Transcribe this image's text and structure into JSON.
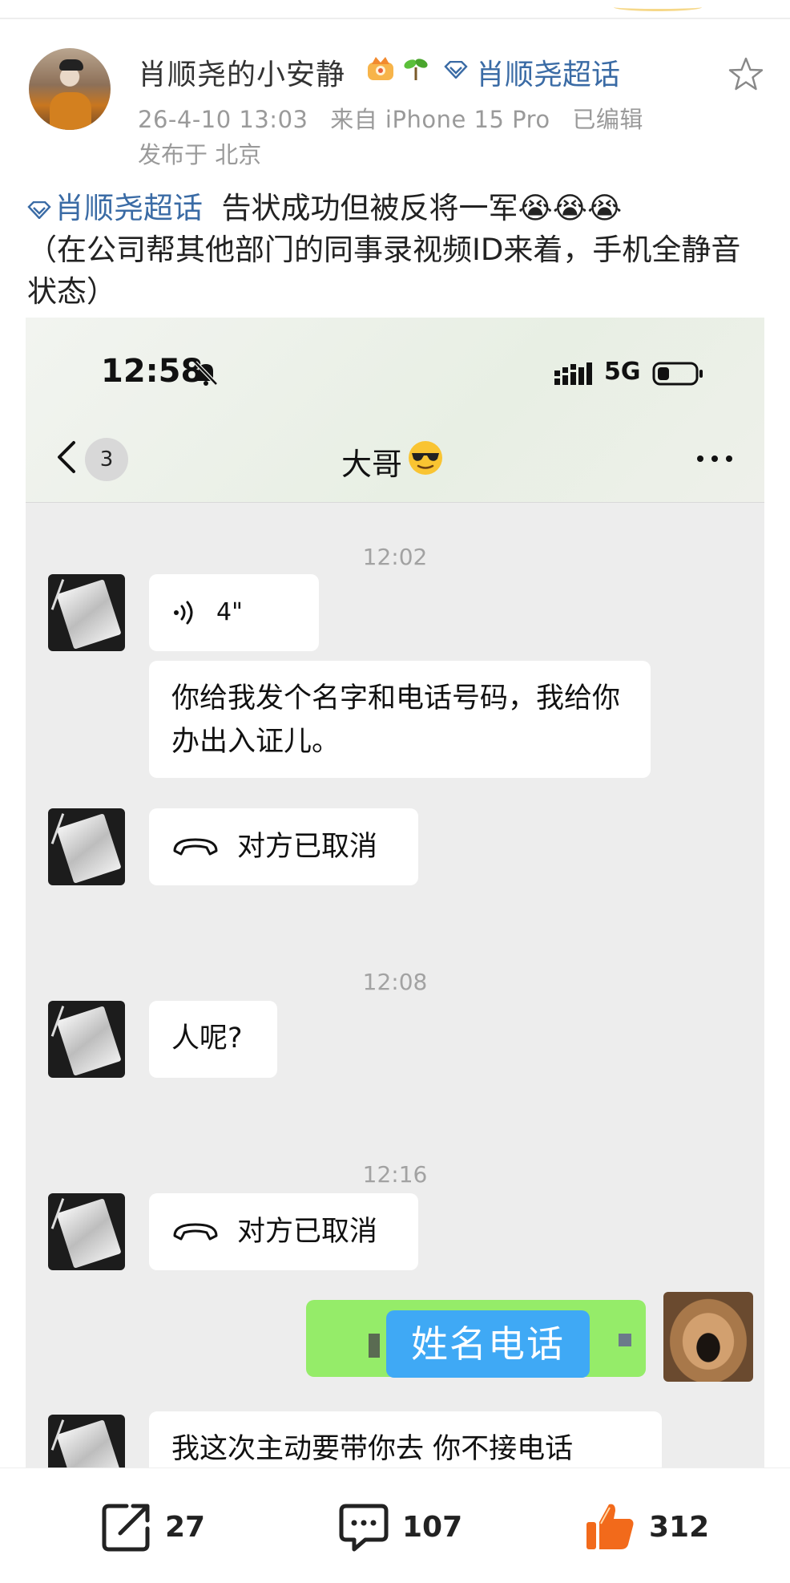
{
  "post": {
    "user_name": "肖顺尧的小安静",
    "topic_label": "肖顺尧超话",
    "meta": {
      "timestamp": "26-4-10 13:03",
      "source": "来自 iPhone 15 Pro",
      "edited": "已编辑"
    },
    "location": "发布于 北京",
    "text_topic": "肖顺尧超话",
    "text_line1": "告状成功但被反将一军",
    "text_emojis": "😭😭😭",
    "text_line2": "（在公司帮其他部门的同事录视频ID来着，手机全静音状态）"
  },
  "phone": {
    "status_time": "12:58",
    "network": "5G",
    "unread_count": "3",
    "chat_title": "大哥"
  },
  "chat": {
    "times": [
      "12:02",
      "12:08",
      "12:16"
    ],
    "voice_length": "4\"",
    "msg_1": "你给我发个名字和电话号码，我给你办出入证儿。",
    "call_cancel_1": "对方已取消",
    "msg_2": "人呢?",
    "call_cancel_2": "对方已取消",
    "sticker_text": "姓名电话",
    "msg_3": "我这次主动要带你去 你不接电话"
  },
  "actions": {
    "share_count": "27",
    "comment_count": "107",
    "like_count": "312"
  },
  "colors": {
    "topic_blue": "#3a6ba5",
    "my_bubble_green": "#95ec69",
    "sticker_blue": "#3fa9f5",
    "like_orange": "#f26a1b"
  }
}
